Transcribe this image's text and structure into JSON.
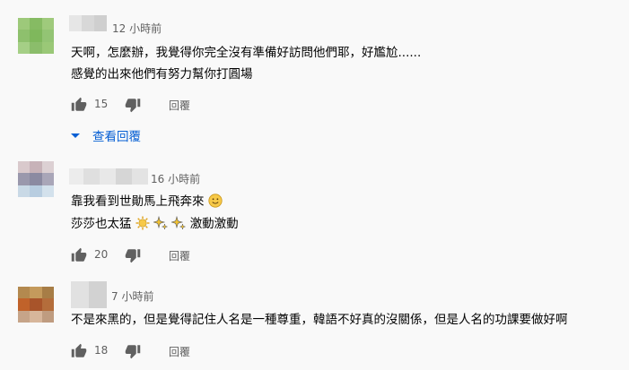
{
  "comments": [
    {
      "time": "12 小時前",
      "lines": [
        "天啊，怎麼辦，我覺得你完全沒有準備好訪問他們耶，好尷尬......",
        "感覺的出來他們有努力幫你打圓場"
      ],
      "likes": "15",
      "reply_label": "回覆",
      "view_replies_label": "查看回覆",
      "avatar_colors": [
        "#9dc97a",
        "#86bb63",
        "#9fca7c",
        "#8ec06d",
        "#7fb85c",
        "#93c474",
        "#a5cf86",
        "#8bbd6b",
        "#9ac877"
      ]
    },
    {
      "time": "16 小時前",
      "lines": [
        "靠我看到世勛馬上飛奔來",
        "莎莎也太猛",
        "激動激動"
      ],
      "likes": "20",
      "reply_label": "回覆",
      "avatar_colors": [
        "#d9c9cc",
        "#c7b2b8",
        "#dcd0d3",
        "#9a98ac",
        "#8b8aa1",
        "#a9a6b8",
        "#c9d9e6",
        "#b8cde0",
        "#d3e1ec"
      ]
    },
    {
      "time": "7 小時前",
      "lines": [
        "不是來黑的，但是覺得記住人名是一種尊重，韓語不好真的沒關係，但是人名的功課要做好啊"
      ],
      "likes": "18",
      "reply_label": "回覆",
      "avatar_colors": [
        "#b3894f",
        "#c49a5c",
        "#a77d46",
        "#c0622a",
        "#a8542a",
        "#b46d3b",
        "#c6a489",
        "#d7b69b",
        "#bf9c80"
      ]
    }
  ]
}
